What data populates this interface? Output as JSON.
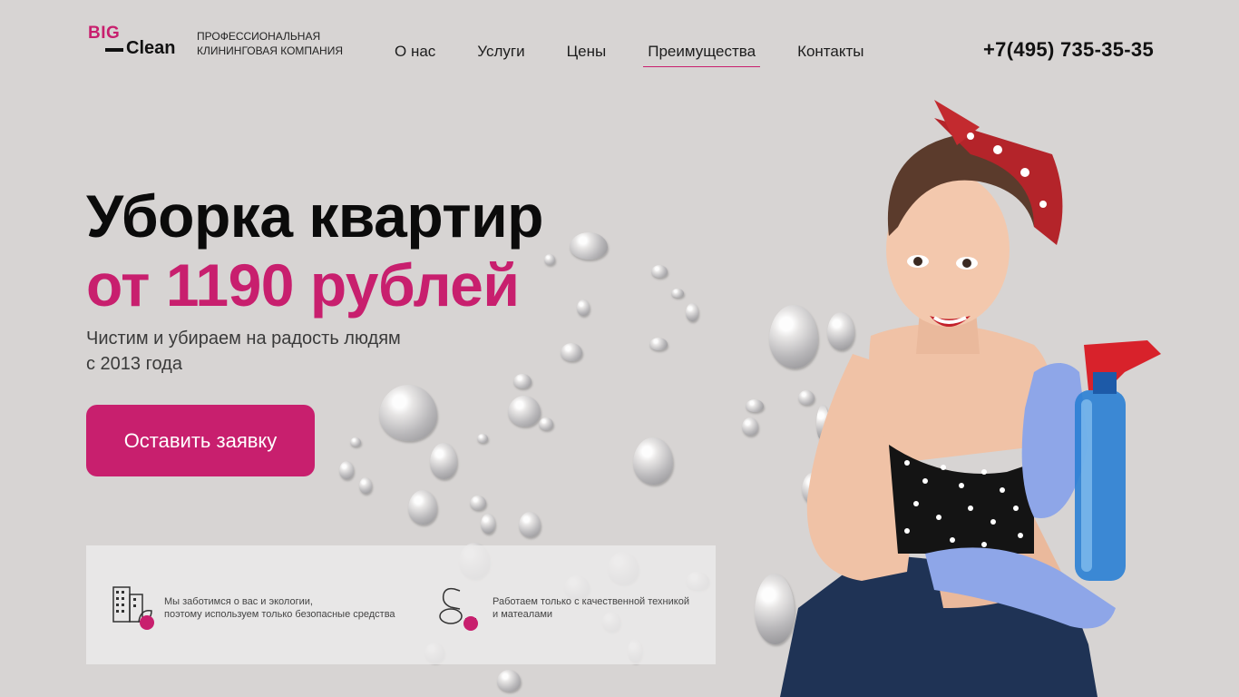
{
  "logo": {
    "big": "BIG",
    "clean": "Clean"
  },
  "tagline": {
    "line1": "ПРОФЕССИОНАЛЬНАЯ",
    "line2": "КЛИНИНГОВАЯ КОМПАНИЯ"
  },
  "nav": {
    "items": [
      {
        "label": "О нас"
      },
      {
        "label": "Услуги"
      },
      {
        "label": "Цены"
      },
      {
        "label": "Преимущества",
        "active": true
      },
      {
        "label": "Контакты"
      }
    ]
  },
  "phone": "+7(495) 735-35-35",
  "hero": {
    "title": "Уборка квартир",
    "price": "от 1190 рублей",
    "subtitle_line1": "Чистим и убираем на радость людям",
    "subtitle_line2": "с 2013 года",
    "cta_label": "Оставить заявку"
  },
  "features": [
    {
      "icon": "eco-building-icon",
      "line1": "Мы заботимся о вас и экологии,",
      "line2": "поэтому используем только безопасные средства"
    },
    {
      "icon": "vacuum-cleaner-icon",
      "line1": "Работаем только с качественной техникой",
      "line2": "и матеалами"
    }
  ],
  "colors": {
    "accent": "#c81f6e",
    "background": "#d7d4d3",
    "text": "#0b0b0b"
  }
}
